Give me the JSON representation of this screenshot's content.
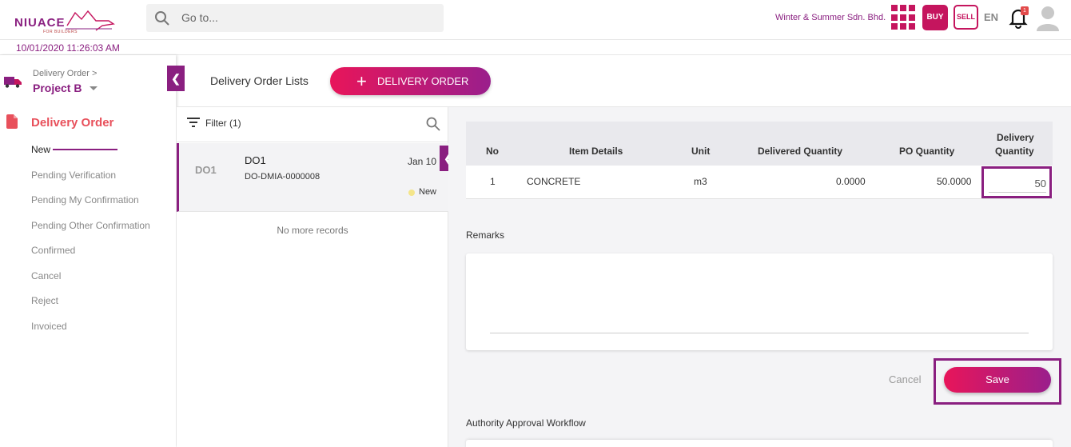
{
  "brand": {
    "logo_text": "NIUACE",
    "logo_tagline": "FOR BUILDERS"
  },
  "header": {
    "search_placeholder": "Go to...",
    "company": "Winter & Summer Sdn. Bhd.",
    "buy_label": "BUY",
    "sell_label": "SELL",
    "language": "EN",
    "notification_count": "1",
    "datetime": "10/01/2020 11:26:03 AM"
  },
  "sidebar": {
    "breadcrumb": "Delivery Order >",
    "project": "Project B",
    "menu_title": "Delivery Order",
    "items": [
      {
        "label": "New",
        "active": true
      },
      {
        "label": "Pending Verification"
      },
      {
        "label": "Pending My Confirmation"
      },
      {
        "label": "Pending Other Confirmation"
      },
      {
        "label": "Confirmed"
      },
      {
        "label": "Cancel"
      },
      {
        "label": "Reject"
      },
      {
        "label": "Invoiced"
      }
    ]
  },
  "page": {
    "title": "Delivery Order Lists",
    "add_button": "DELIVERY ORDER"
  },
  "list": {
    "filter_label": "Filter (1)",
    "records": [
      {
        "code": "DO1",
        "title": "DO1",
        "number": "DO-DMIA-0000008",
        "date": "Jan 10",
        "status": "New"
      }
    ],
    "end_text": "No more records"
  },
  "detail": {
    "table": {
      "headers": {
        "no": "No",
        "item": "Item Details",
        "unit": "Unit",
        "delivered": "Delivered Quantity",
        "po": "PO Quantity",
        "delivery_line1": "Delivery",
        "delivery_line2": "Quantity"
      },
      "rows": [
        {
          "no": "1",
          "item": "CONCRETE",
          "unit": "m3",
          "delivered": "0.0000",
          "po": "50.0000",
          "delivery": "50"
        }
      ]
    },
    "remarks_label": "Remarks",
    "remarks_value": "",
    "cancel_label": "Cancel",
    "save_label": "Save",
    "authority_label": "Authority Approval Workflow"
  },
  "colors": {
    "brand_purple": "#8a1f80",
    "brand_pink": "#c5155e",
    "menu_active": "#e8505b"
  }
}
